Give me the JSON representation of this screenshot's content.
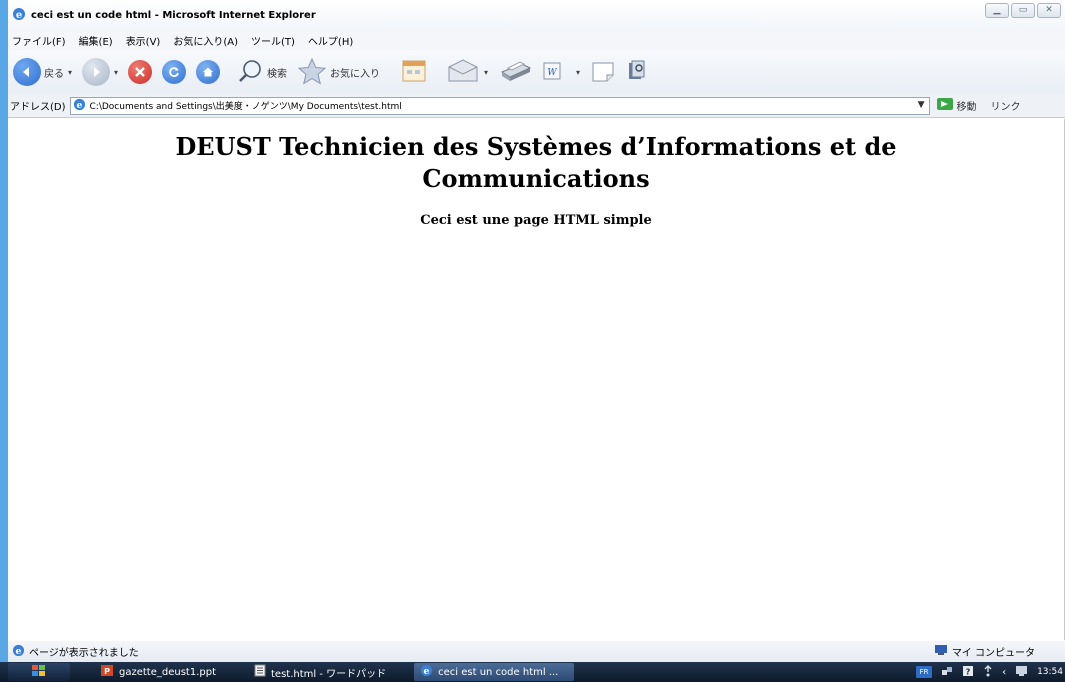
{
  "window": {
    "title": "ceci est un code html - Microsoft Internet Explorer"
  },
  "menubar": {
    "items": [
      "ファイル(F)",
      "編集(E)",
      "表示(V)",
      "お気に入り(A)",
      "ツール(T)",
      "ヘルプ(H)"
    ]
  },
  "toolbar": {
    "back_label": "戻る",
    "search_label": "検索",
    "favorites_label": "お気に入り"
  },
  "addressbar": {
    "label": "アドレス(D)",
    "url": "C:\\Documents and Settings\\出美度・ノゲンツ\\My Documents\\test.html",
    "go_label": "移動",
    "links_label": "リンク"
  },
  "page": {
    "heading": "DEUST Technicien des Systèmes d’Informations et de Communications",
    "subheading": "Ceci est une page HTML simple"
  },
  "statusbar": {
    "text": "ページが表示されました",
    "zone": "マイ コンピュータ"
  },
  "taskbar": {
    "tasks": [
      {
        "label": "gazette_deust1.ppt"
      },
      {
        "label": "test.html - ワードパッド"
      },
      {
        "label": "ceci est un code html ..."
      }
    ],
    "language": "FR",
    "clock": "13:54"
  },
  "colors": {
    "desktop": "#5aa7e6",
    "back_button": "#2f6fd0",
    "stop_button": "#c8302a",
    "refresh_button": "#2f6fd0",
    "home_button": "#2f6fd0"
  }
}
